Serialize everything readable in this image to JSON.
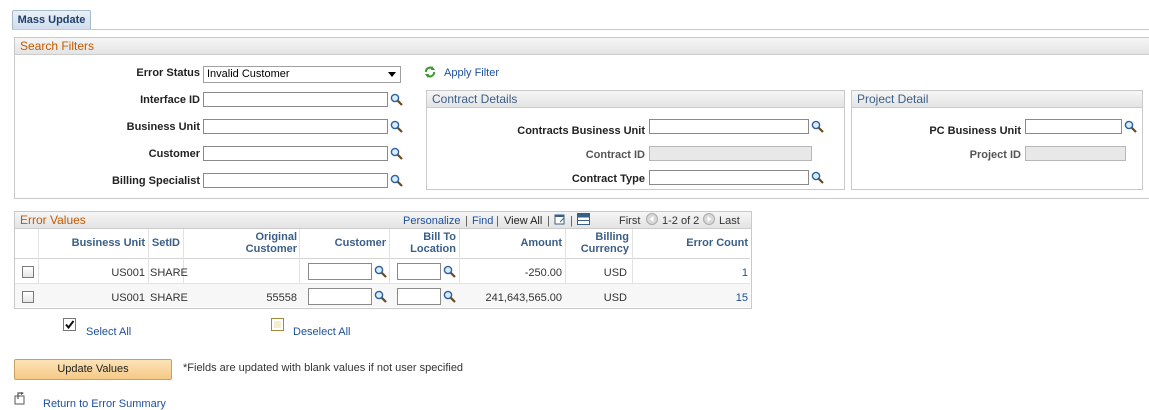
{
  "tab": {
    "label": "Mass Update"
  },
  "search_filters": {
    "title": "Search Filters",
    "error_status_label": "Error Status",
    "error_status_value": "Invalid Customer",
    "apply_filter": "Apply Filter",
    "interface_id_label": "Interface ID",
    "business_unit_label": "Business Unit",
    "customer_label": "Customer",
    "billing_specialist_label": "Billing Specialist",
    "contract_details": {
      "title": "Contract Details",
      "contracts_bu_label": "Contracts Business Unit",
      "contract_id_label": "Contract ID",
      "contract_type_label": "Contract Type"
    },
    "project_detail": {
      "title": "Project Detail",
      "pc_bu_label": "PC Business Unit",
      "project_id_label": "Project ID"
    }
  },
  "error_values": {
    "title": "Error Values",
    "personalize": "Personalize",
    "find": "Find",
    "view_all": "View All",
    "sep": "|",
    "first": "First",
    "range": "1-2 of 2",
    "last": "Last",
    "columns": {
      "business_unit": "Business Unit",
      "setid": "SetID",
      "original_customer_1": "Original",
      "original_customer_2": "Customer",
      "customer": "Customer",
      "bill_to_1": "Bill To",
      "bill_to_2": "Location",
      "amount": "Amount",
      "billing_currency_1": "Billing",
      "billing_currency_2": "Currency",
      "error_count": "Error Count"
    },
    "rows": [
      {
        "business_unit": "US001",
        "setid": "SHARE",
        "original_customer": "",
        "amount": "-250.00",
        "currency": "USD",
        "error_count": "1"
      },
      {
        "business_unit": "US001",
        "setid": "SHARE",
        "original_customer": "55558",
        "amount": "241,643,565.00",
        "currency": "USD",
        "error_count": "15"
      }
    ]
  },
  "select_all": "Select All",
  "deselect_all": "Deselect All",
  "update_values": "Update Values",
  "update_note": "*Fields are updated with blank values if not user specified",
  "return_link": "Return to Error Summary"
}
